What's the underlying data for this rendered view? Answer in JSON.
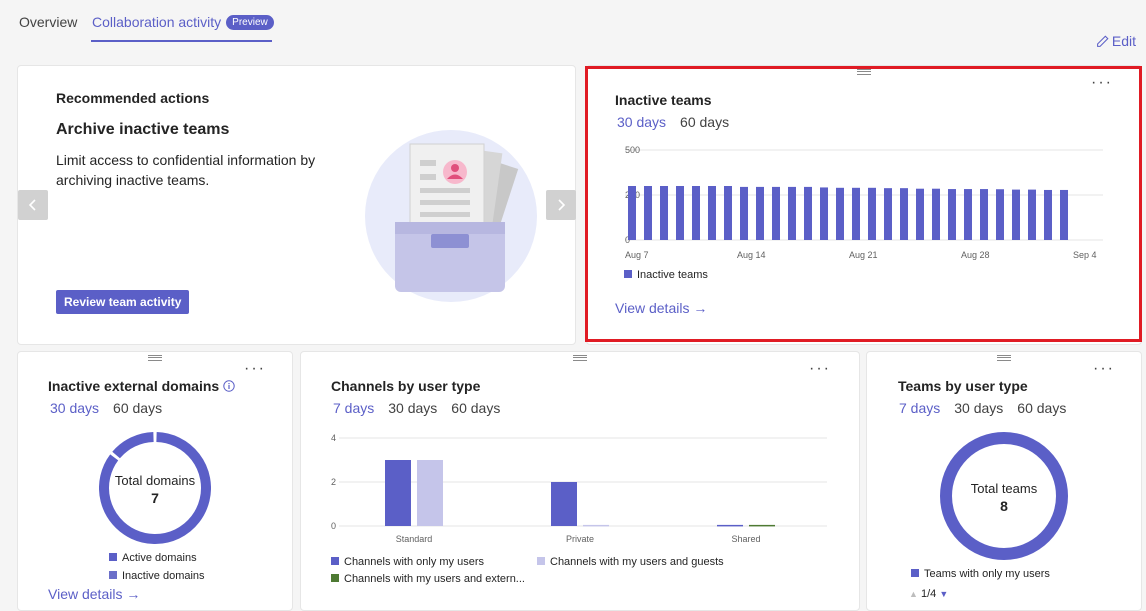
{
  "tabs": {
    "overview": "Overview",
    "collab": "Collaboration activity",
    "badge": "Preview"
  },
  "edit_label": "Edit",
  "recommended": {
    "heading": "Recommended actions",
    "title": "Archive inactive teams",
    "description": "Limit access to confidential information by archiving inactive teams.",
    "button": "Review team activity"
  },
  "inactive_teams": {
    "title": "Inactive teams",
    "ranges": [
      "30 days",
      "60 days"
    ],
    "selected_range": "30 days",
    "legend": "Inactive teams",
    "view_details": "View details →",
    "chart_data": {
      "type": "bar",
      "ylim": [
        0,
        500
      ],
      "yticks": [
        "500",
        "250",
        "0"
      ],
      "xticks": [
        "Aug 7",
        "Aug 14",
        "Aug 21",
        "Aug 28",
        "Sep 4"
      ],
      "values": [
        300,
        300,
        300,
        300,
        300,
        300,
        300,
        295,
        295,
        295,
        295,
        295,
        292,
        290,
        290,
        290,
        288,
        288,
        285,
        285,
        283,
        283,
        283,
        282,
        280,
        280,
        278,
        278
      ],
      "color": "#5b5fc7"
    }
  },
  "external_domains": {
    "title": "Inactive external domains",
    "ranges": [
      "30 days",
      "60 days"
    ],
    "selected_range": "30 days",
    "center_label": "Total domains",
    "center_value": "7",
    "legend": [
      "Active domains",
      "Inactive domains"
    ],
    "view_details": "View details →",
    "chart_data": {
      "type": "pie",
      "labels": [
        "Active domains",
        "Inactive domains"
      ],
      "values": [
        6,
        1
      ],
      "colors": [
        "#5b5fc7",
        "#5b5fc7"
      ]
    }
  },
  "channels": {
    "title": "Channels by user type",
    "ranges": [
      "7 days",
      "30 days",
      "60 days"
    ],
    "selected_range": "7 days",
    "legend": [
      "Channels with only my users",
      "Channels with my users and guests",
      "Channels with my users and extern..."
    ],
    "chart_data": {
      "type": "bar",
      "categories": [
        "Standard",
        "Private",
        "Shared"
      ],
      "yticks": [
        "4",
        "2",
        "0"
      ],
      "ylim": [
        0,
        4
      ],
      "series": [
        {
          "name": "Channels with only my users",
          "values": [
            3,
            2,
            0.05
          ],
          "color": "#5b5fc7"
        },
        {
          "name": "Channels with my users and guests",
          "values": [
            3,
            0.05,
            0
          ],
          "color": "#c5c5ea"
        },
        {
          "name": "Channels with my users and extern...",
          "values": [
            0,
            0,
            0.05
          ],
          "color": "#4e7a33"
        }
      ]
    }
  },
  "teams_user_type": {
    "title": "Teams by user type",
    "ranges": [
      "7 days",
      "30 days",
      "60 days"
    ],
    "selected_range": "7 days",
    "center_label": "Total teams",
    "center_value": "8",
    "legend": "Teams with only my users",
    "pager": "1/4",
    "chart_data": {
      "type": "pie",
      "labels": [
        "Teams with only my users"
      ],
      "values": [
        8
      ],
      "colors": [
        "#5b5fc7"
      ]
    }
  }
}
